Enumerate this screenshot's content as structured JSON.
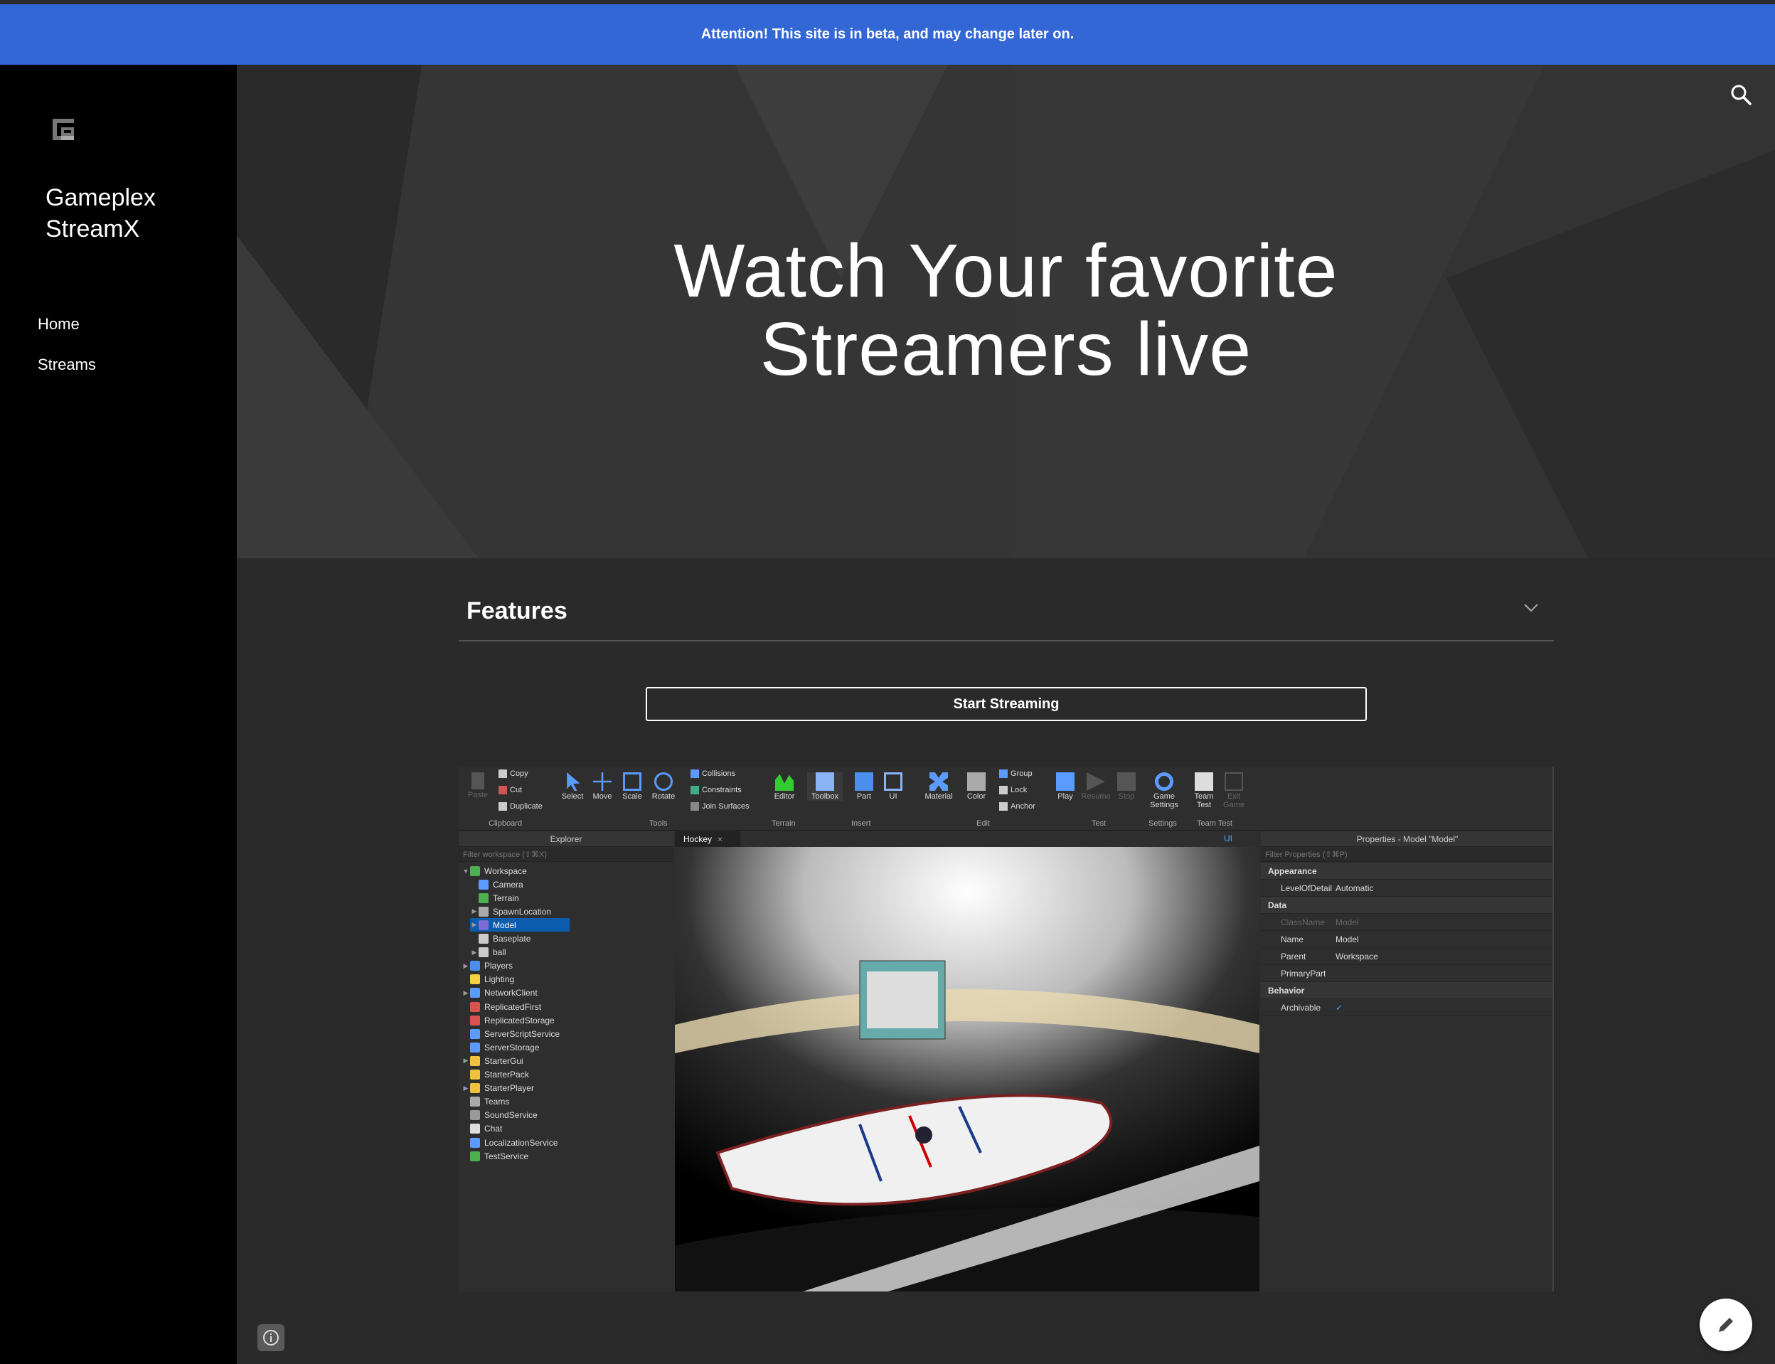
{
  "banner": {
    "text": "Attention! This site is in beta, and may change later on."
  },
  "sidebar": {
    "site_title": "Gameplex\nStreamX",
    "nav": [
      {
        "label": "Home"
      },
      {
        "label": "Streams"
      }
    ]
  },
  "hero": {
    "title": "Watch Your favorite\nStreamers live"
  },
  "features": {
    "heading": "Features",
    "button_label": "Start Streaming"
  },
  "studio": {
    "ribbon": {
      "clipboard": {
        "paste": "Paste",
        "copy": "Copy",
        "cut": "Cut",
        "duplicate": "Duplicate",
        "group": "Clipboard"
      },
      "tools": {
        "select": "Select",
        "move": "Move",
        "scale": "Scale",
        "rotate": "Rotate",
        "collisions": "Collisions",
        "constraints": "Constraints",
        "join": "Join Surfaces",
        "group": "Tools"
      },
      "terrain": {
        "editor": "Editor",
        "group": "Terrain"
      },
      "insert": {
        "toolbox": "Toolbox",
        "part": "Part",
        "ui": "UI",
        "group": "Insert"
      },
      "edit": {
        "material": "Material",
        "color": "Color",
        "group_btn": "Group",
        "lock": "Lock",
        "anchor": "Anchor",
        "group": "Edit"
      },
      "test": {
        "play": "Play",
        "resume": "Resume",
        "stop": "Stop",
        "group": "Test"
      },
      "settings": {
        "game_settings": "Game Settings",
        "group": "Settings"
      },
      "team_test": {
        "team_test": "Team Test",
        "exit_game": "Exit Game",
        "group": "Team Test"
      }
    },
    "explorer": {
      "title": "Explorer",
      "filter": "Filter workspace (⇧⌘X)",
      "items": [
        {
          "label": "Workspace"
        },
        {
          "label": "Camera"
        },
        {
          "label": "Terrain"
        },
        {
          "label": "SpawnLocation"
        },
        {
          "label": "Model"
        },
        {
          "label": "Baseplate"
        },
        {
          "label": "ball"
        },
        {
          "label": "Players"
        },
        {
          "label": "Lighting"
        },
        {
          "label": "NetworkClient"
        },
        {
          "label": "ReplicatedFirst"
        },
        {
          "label": "ReplicatedStorage"
        },
        {
          "label": "ServerScriptService"
        },
        {
          "label": "ServerStorage"
        },
        {
          "label": "StarterGui"
        },
        {
          "label": "StarterPack"
        },
        {
          "label": "StarterPlayer"
        },
        {
          "label": "Teams"
        },
        {
          "label": "SoundService"
        },
        {
          "label": "Chat"
        },
        {
          "label": "LocalizationService"
        },
        {
          "label": "TestService"
        }
      ]
    },
    "viewport": {
      "tab": "Hockey",
      "ui_toggle": "UI"
    },
    "properties": {
      "title": "Properties - Model \"Model\"",
      "filter": "Filter Properties (⇧⌘P)",
      "appearance": "Appearance",
      "lod_key": "LevelOfDetail",
      "lod_val": "Automatic",
      "data": "Data",
      "classname_key": "ClassName",
      "classname_val": "Model",
      "name_key": "Name",
      "name_val": "Model",
      "parent_key": "Parent",
      "parent_val": "Workspace",
      "primarypart_key": "PrimaryPart",
      "behavior": "Behavior",
      "archivable_key": "Archivable",
      "archivable_val": "✓"
    }
  },
  "colors": {
    "banner": "#3367d6",
    "sidebar": "#000000",
    "hero": "#303030",
    "main": "#2a2a2a",
    "selection": "#0b5cad"
  }
}
